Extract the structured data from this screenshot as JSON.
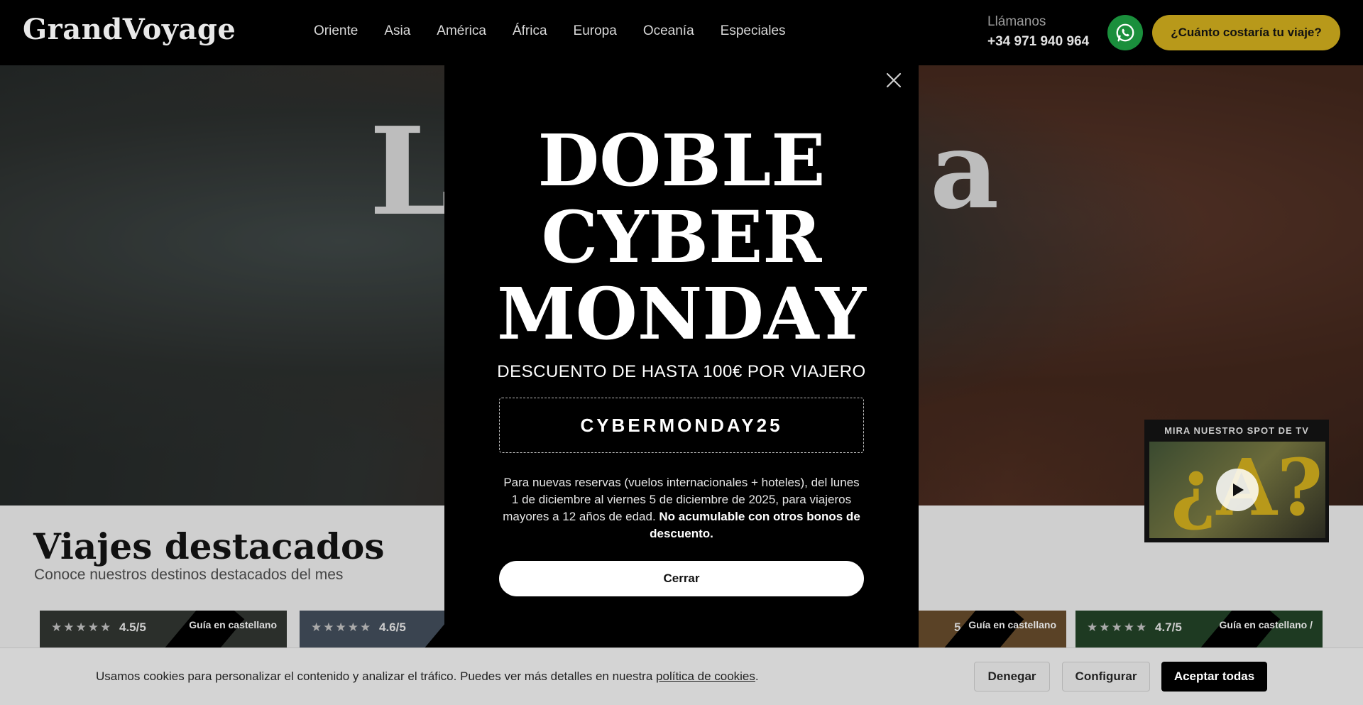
{
  "header": {
    "logo": "GrandVoyage",
    "nav": [
      "Oriente",
      "Asia",
      "América",
      "África",
      "Europa",
      "Oceanía",
      "Especiales"
    ],
    "call_label": "Llámanos",
    "call_phone": "+34 971 940 964",
    "quote_button": "¿Cuánto costaría tu viaje?"
  },
  "hero": {
    "title_left_fragment": "L",
    "title_right_fragment": "a"
  },
  "modal": {
    "headline_1": "DOBLE",
    "headline_2": "CYBER",
    "headline_3": "MONDAY",
    "discount": "DESCUENTO DE HASTA 100€ POR VIAJERO",
    "coupon_code": "CYBERMONDAY25",
    "terms": "Para nuevas reservas (vuelos internacionales + hoteles), del lunes 1 de diciembre al viernes 5 de diciembre de 2025, para viajeros mayores a 12 años de edad.",
    "terms_bold": "No acumulable con otros bonos de descuento.",
    "close_button": "Cerrar",
    "close_icon": "close-icon"
  },
  "featured": {
    "title": "Viajes destacados",
    "subtitle": "Conoce nuestros destinos destacados del mes",
    "cards": [
      {
        "rating": "4.5/5",
        "guide": "Guía en castellano"
      },
      {
        "rating": "4.6/5",
        "guide": ""
      },
      {
        "rating": "",
        "guide": ""
      },
      {
        "rating": "5",
        "guide": "Guía en castellano"
      },
      {
        "rating": "4.7/5",
        "guide": "Guía en castellano /"
      }
    ]
  },
  "tv_spot": {
    "label": "MIRA NUESTRO SPOT DE TV"
  },
  "cookie": {
    "text_before": "Usamos cookies para personalizar el contenido y analizar el tráfico. Puedes ver más detalles en nuestra",
    "link": "política de cookies",
    "text_after": ".",
    "deny": "Denegar",
    "configure": "Configurar",
    "accept": "Aceptar todas"
  },
  "colors": {
    "accent_gold": "#b8991a",
    "whatsapp_green": "#1a8f3c",
    "header_bg": "#000000"
  }
}
